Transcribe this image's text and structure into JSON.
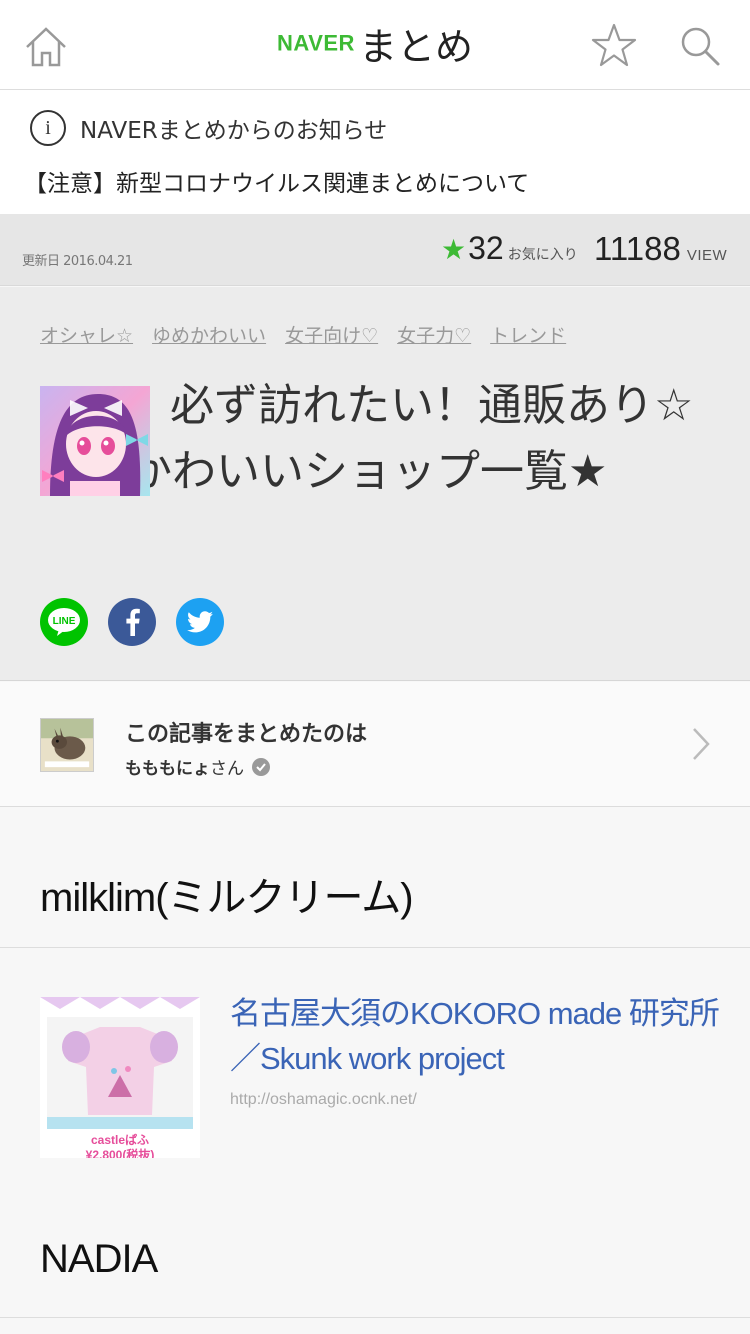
{
  "header": {
    "logo_naver": "NAVER",
    "logo_matome": "まとめ",
    "icons": [
      "home-icon",
      "star-outline-icon",
      "search-icon"
    ]
  },
  "notice": {
    "title": "NAVERまとめからのお知らせ",
    "link": "【注意】新型コロナウイルス関連まとめについて"
  },
  "meta": {
    "updated": "更新日 2016.04.21",
    "favorites_count": "32",
    "favorites_label": "お気に入り",
    "views_count": "11188",
    "views_label": "VIEW"
  },
  "article": {
    "tags": [
      "オシャレ☆",
      "ゆめかわいい",
      "女子向け♡",
      "女子力♡",
      "トレンド"
    ],
    "title": "必ず訪れたい！通販あり☆ゆめかわいいショップ一覧★"
  },
  "share": {
    "line_label": "LINE",
    "colors": {
      "line": "#00c300",
      "facebook": "#3b5998",
      "twitter": "#1da1f2"
    }
  },
  "author": {
    "heading": "この記事をまとめたのは",
    "name": "もももにょ",
    "suffix": "さん"
  },
  "sections": [
    {
      "title": "milklim(ミルクリーム)",
      "link": {
        "title": "名古屋大須のKOKORO made 研究所／Skunk work project",
        "url": "http://oshamagic.ocnk.net/",
        "thumb_caption": "castleぱふ",
        "thumb_price": "¥2,800(税抜)"
      }
    },
    {
      "title": "NADIA"
    }
  ],
  "colors": {
    "brand": "#3dba35",
    "link": "#3a64b6"
  }
}
